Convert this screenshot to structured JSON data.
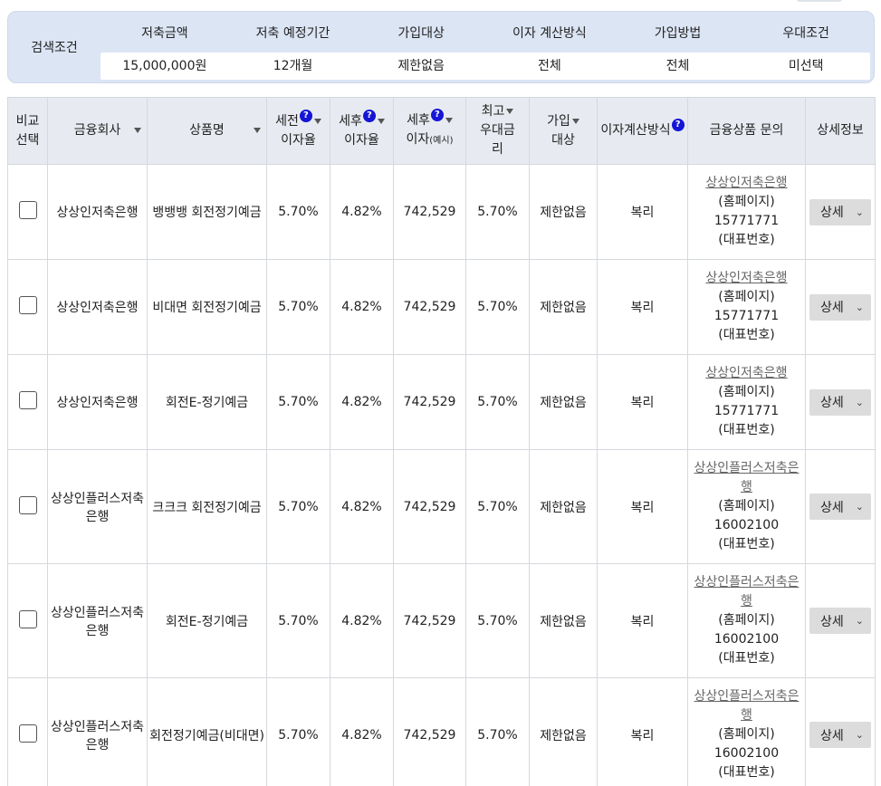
{
  "search": {
    "label": "검색조건",
    "headers": [
      "저축금액",
      "저축 예정기간",
      "가입대상",
      "이자 계산방식",
      "가입방법",
      "우대조건"
    ],
    "values": [
      "15,000,000원",
      "12개월",
      "제한없음",
      "전체",
      "전체",
      "미선택"
    ]
  },
  "table": {
    "headers": {
      "compare_1": "비교",
      "compare_2": "선택",
      "company": "금융회사",
      "product": "상품명",
      "pretax_1": "세전",
      "pretax_2": "이자율",
      "aftertax_1": "세후",
      "aftertax_2": "이자율",
      "interest_1": "세후",
      "interest_2": "이자",
      "interest_small": "(예시)",
      "pref_1": "최고",
      "pref_2": "우대금",
      "pref_3": "리",
      "target_1": "가입",
      "target_2": "대상",
      "calc": "이자계산방식",
      "inquiry": "금융상품 문의",
      "detail": "상세정보",
      "help_glyph": "?"
    },
    "rows": [
      {
        "company": "상상인저축은행",
        "product": "뱅뱅뱅 회전정기예금",
        "pretax": "5.70%",
        "aftertax": "4.82%",
        "interest": "742,529",
        "pref": "5.70%",
        "target": "제한없음",
        "calc": "복리",
        "inq_link": "상상인저축은행",
        "inq_home": "(홈페이지)",
        "inq_phone": "15771771",
        "inq_rep": "(대표번호)",
        "detail": "상세"
      },
      {
        "company": "상상인저축은행",
        "product": "비대면 회전정기예금",
        "pretax": "5.70%",
        "aftertax": "4.82%",
        "interest": "742,529",
        "pref": "5.70%",
        "target": "제한없음",
        "calc": "복리",
        "inq_link": "상상인저축은행",
        "inq_home": "(홈페이지)",
        "inq_phone": "15771771",
        "inq_rep": "(대표번호)",
        "detail": "상세"
      },
      {
        "company": "상상인저축은행",
        "product": "회전E-정기예금",
        "pretax": "5.70%",
        "aftertax": "4.82%",
        "interest": "742,529",
        "pref": "5.70%",
        "target": "제한없음",
        "calc": "복리",
        "inq_link": "상상인저축은행",
        "inq_home": "(홈페이지)",
        "inq_phone": "15771771",
        "inq_rep": "(대표번호)",
        "detail": "상세"
      },
      {
        "company": "상상인플러스저축은행",
        "product": "크크크 회전정기예금",
        "pretax": "5.70%",
        "aftertax": "4.82%",
        "interest": "742,529",
        "pref": "5.70%",
        "target": "제한없음",
        "calc": "복리",
        "inq_link": "상상인플러스저축은행",
        "inq_home": "(홈페이지)",
        "inq_phone": "16002100",
        "inq_rep": "(대표번호)",
        "detail": "상세"
      },
      {
        "company": "상상인플러스저축은행",
        "product": "회전E-정기예금",
        "pretax": "5.70%",
        "aftertax": "4.82%",
        "interest": "742,529",
        "pref": "5.70%",
        "target": "제한없음",
        "calc": "복리",
        "inq_link": "상상인플러스저축은행",
        "inq_home": "(홈페이지)",
        "inq_phone": "16002100",
        "inq_rep": "(대표번호)",
        "detail": "상세"
      },
      {
        "company": "상상인플러스저축은행",
        "product": "회전정기예금(비대면)",
        "pretax": "5.70%",
        "aftertax": "4.82%",
        "interest": "742,529",
        "pref": "5.70%",
        "target": "제한없음",
        "calc": "복리",
        "inq_link": "상상인플러스저축은행",
        "inq_home": "(홈페이지)",
        "inq_phone": "16002100",
        "inq_rep": "(대표번호)",
        "detail": "상세"
      }
    ]
  }
}
